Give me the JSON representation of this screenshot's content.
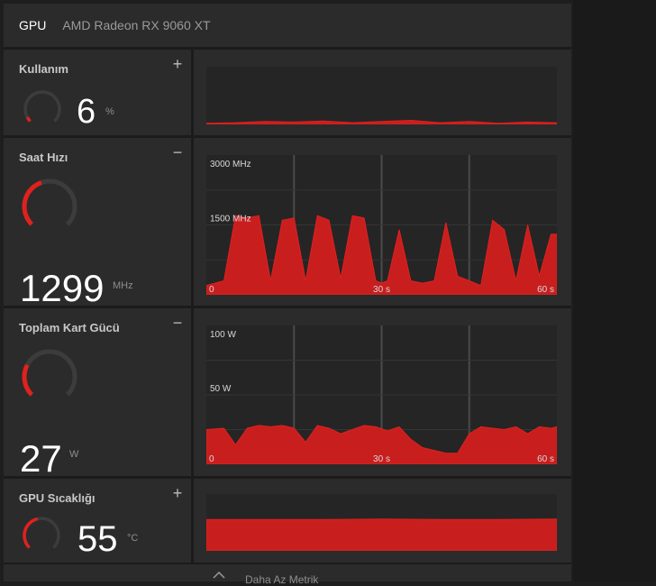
{
  "header": {
    "title": "GPU",
    "model": "AMD Radeon RX 9060 XT"
  },
  "colors": {
    "accent": "#e0211e",
    "fill": "#c81e1e",
    "panel": "#2b2b2b",
    "chart_bg": "#252525",
    "grid": "#4a4a4a"
  },
  "metrics": [
    {
      "title": "Kullanım",
      "value": "6",
      "unit": "%",
      "toggle": "+",
      "gauge_fraction": 0.06,
      "chart_data": {
        "type": "area",
        "xlim": [
          0,
          60
        ],
        "ylim": [
          0,
          100
        ],
        "grid": false,
        "x_labels": [],
        "y_labels": [],
        "x": [
          0,
          5,
          10,
          15,
          20,
          25,
          30,
          35,
          40,
          45,
          50,
          55,
          60
        ],
        "values": [
          2,
          3,
          5,
          4,
          6,
          3,
          5,
          7,
          3,
          5,
          2,
          4,
          3
        ]
      }
    },
    {
      "title": "Saat Hızı",
      "value": "1299",
      "unit": "MHz",
      "toggle": "−",
      "gauge_fraction": 0.43,
      "chart_data": {
        "type": "area",
        "xlim": [
          0,
          60
        ],
        "ylim": [
          0,
          3000
        ],
        "grid": true,
        "x_labels": [
          "0",
          "30 s",
          "60 s"
        ],
        "y_labels": [
          "3000 MHz",
          "1500 MHz"
        ],
        "x": [
          0,
          3,
          5,
          7,
          9,
          11,
          13,
          15,
          17,
          19,
          21,
          23,
          25,
          27,
          29,
          30,
          31,
          33,
          35,
          37,
          39,
          41,
          43,
          45,
          47,
          49,
          51,
          53,
          55,
          57,
          59,
          60
        ],
        "values": [
          200,
          300,
          1700,
          1650,
          1700,
          300,
          1600,
          1650,
          300,
          1700,
          1600,
          350,
          1700,
          1650,
          300,
          250,
          300,
          1400,
          300,
          250,
          300,
          1550,
          400,
          300,
          200,
          1600,
          1400,
          300,
          1500,
          400,
          1300,
          1300
        ]
      }
    },
    {
      "title": "Toplam Kart Gücü",
      "value": "27",
      "unit": "W",
      "toggle": "−",
      "gauge_fraction": 0.27,
      "chart_data": {
        "type": "area",
        "xlim": [
          0,
          60
        ],
        "ylim": [
          0,
          100
        ],
        "grid": true,
        "x_labels": [
          "0",
          "30 s",
          "60 s"
        ],
        "y_labels": [
          "100 W",
          "50 W"
        ],
        "x": [
          0,
          3,
          5,
          7,
          9,
          11,
          13,
          15,
          17,
          19,
          21,
          23,
          25,
          27,
          29,
          31,
          33,
          35,
          37,
          39,
          41,
          43,
          45,
          47,
          49,
          51,
          53,
          55,
          57,
          59,
          60
        ],
        "values": [
          25,
          26,
          14,
          26,
          28,
          27,
          28,
          26,
          16,
          28,
          26,
          22,
          25,
          28,
          27,
          24,
          27,
          18,
          12,
          10,
          8,
          8,
          22,
          27,
          26,
          25,
          27,
          22,
          27,
          26,
          27
        ]
      }
    },
    {
      "title": "GPU Sıcaklığı",
      "value": "55",
      "unit": "°C",
      "toggle": "+",
      "gauge_fraction": 0.45,
      "chart_data": {
        "type": "area",
        "xlim": [
          0,
          60
        ],
        "ylim": [
          0,
          100
        ],
        "grid": false,
        "x_labels": [],
        "y_labels": [],
        "x": [
          0,
          10,
          20,
          30,
          40,
          50,
          60
        ],
        "values": [
          55,
          55,
          55,
          56,
          55,
          55,
          56
        ]
      }
    }
  ],
  "footer": {
    "label": "Daha Az Metrik"
  }
}
